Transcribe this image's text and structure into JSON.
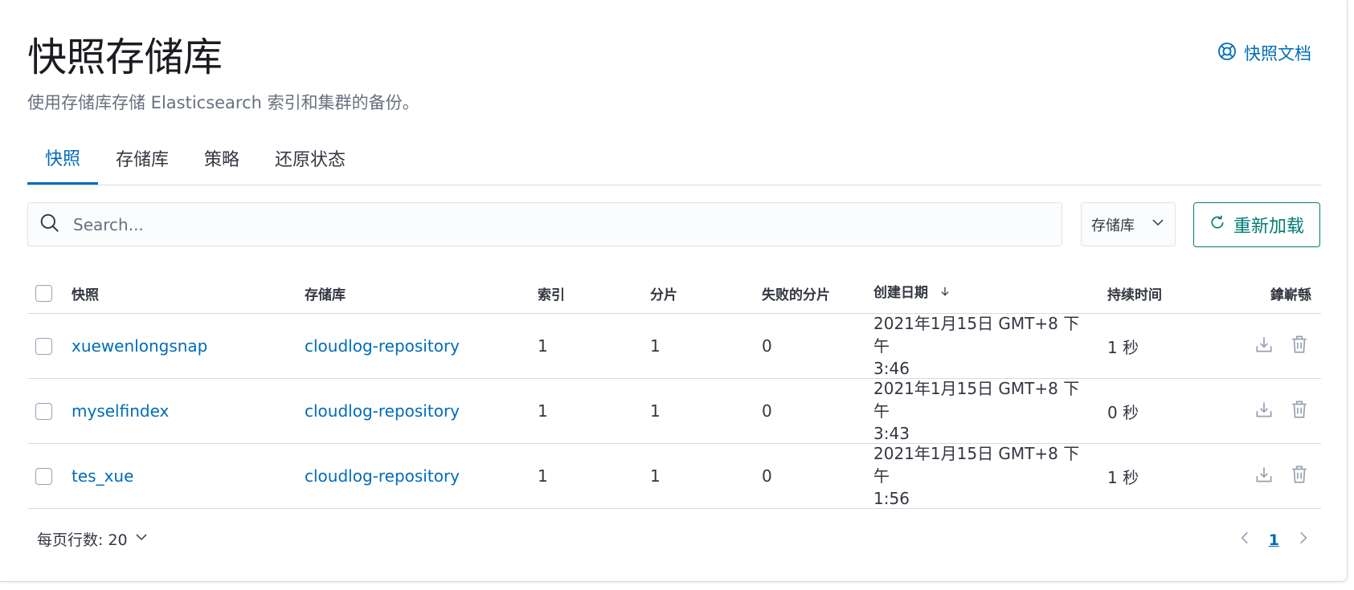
{
  "header": {
    "title": "快照存储库",
    "description": "使用存储库存储 Elasticsearch 索引和集群的备份。",
    "doc_link": "快照文档"
  },
  "tabs": [
    {
      "label": "快照",
      "active": true
    },
    {
      "label": "存储库",
      "active": false
    },
    {
      "label": "策略",
      "active": false
    },
    {
      "label": "还原状态",
      "active": false
    }
  ],
  "toolbar": {
    "search_placeholder": "Search...",
    "filter_label": "存储库",
    "reload_label": "重新加载"
  },
  "table": {
    "columns": {
      "snapshot": "快照",
      "repository": "存储库",
      "indices": "索引",
      "shards": "分片",
      "failed_shards": "失败的分片",
      "created": "创建日期",
      "duration": "持续时间",
      "actions": "鎿嶄綔"
    },
    "rows": [
      {
        "snapshot": "xuewenlongsnap",
        "repository": "cloudlog-repository",
        "indices": "1",
        "shards": "1",
        "failed": "0",
        "date_line1": "2021年1月15日 GMT+8 下午",
        "date_line2": "3:46",
        "duration": "1 秒"
      },
      {
        "snapshot": "myselfindex",
        "repository": "cloudlog-repository",
        "indices": "1",
        "shards": "1",
        "failed": "0",
        "date_line1": "2021年1月15日 GMT+8 下午",
        "date_line2": "3:43",
        "duration": "0 秒"
      },
      {
        "snapshot": "tes_xue",
        "repository": "cloudlog-repository",
        "indices": "1",
        "shards": "1",
        "failed": "0",
        "date_line1": "2021年1月15日 GMT+8 下午",
        "date_line2": "1:56",
        "duration": "1 秒"
      }
    ]
  },
  "pagination": {
    "rows_per_page": "每页行数: 20",
    "current_page": "1"
  },
  "colors": {
    "accent": "#006bb8",
    "reload": "#017d73",
    "border": "#d3dae6"
  }
}
